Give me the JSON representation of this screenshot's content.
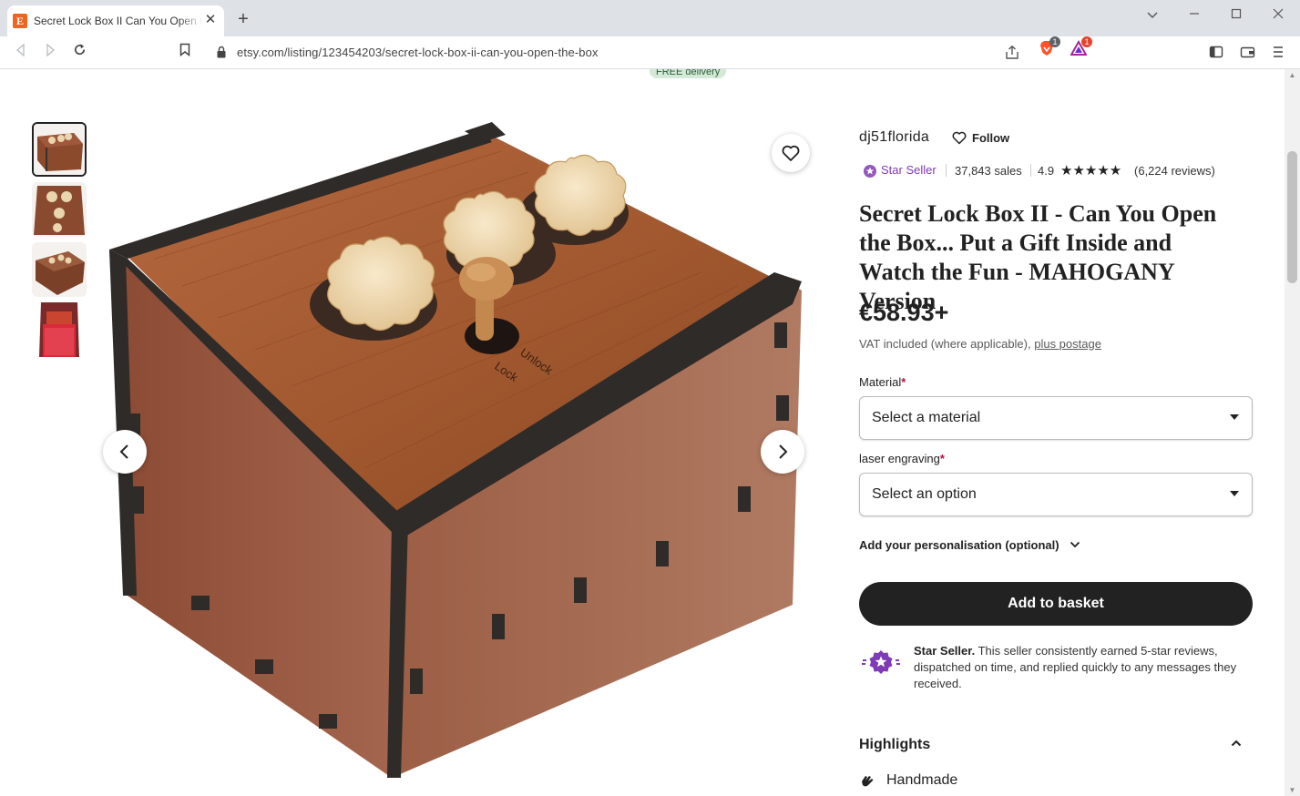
{
  "browser": {
    "tab_title": "Secret Lock Box II Can You Open the Box... Put a Gift Inside and Watch the Fun - MAHOGANY Version",
    "favicon_letter": "E",
    "url": "etsy.com/listing/123454203/secret-lock-box-ii-can-you-open-the-box",
    "brave_badge": "1",
    "rewards_badge": "1"
  },
  "banner": {
    "free_delivery": "FREE delivery"
  },
  "listing": {
    "shop_name": "dj51florida",
    "follow_label": "Follow",
    "star_seller_label": "Star Seller",
    "sales": "37,843 sales",
    "rating": "4.9",
    "stars": "★★★★★",
    "reviews": "(6,224 reviews)",
    "title": "Secret Lock Box II - Can You Open the Box... Put a Gift Inside and Watch the Fun - MAHOGANY Version",
    "price": "€58.93+",
    "vat_text": "VAT included (where applicable), ",
    "postage_link": "plus postage",
    "material_label": "Material",
    "material_placeholder": "Select a material",
    "engraving_label": "laser engraving",
    "engraving_placeholder": "Select an option",
    "required_mark": "*",
    "personalisation_label": "Add your personalisation (optional)",
    "add_to_basket": "Add to basket",
    "star_seller_heading": "Star Seller.",
    "star_seller_desc": " This seller consistently earned 5-star reviews, dispatched on time, and replied quickly to any messages they received.",
    "highlights_label": "Highlights",
    "handmade_label": "Handmade"
  },
  "image": {
    "lid_text_unlock": "Unlock",
    "lid_text_lock": "Lock"
  },
  "colors": {
    "star_seller_purple": "#7f3bb5",
    "button_dark": "#222222",
    "etsy_orange": "#f1641e"
  }
}
